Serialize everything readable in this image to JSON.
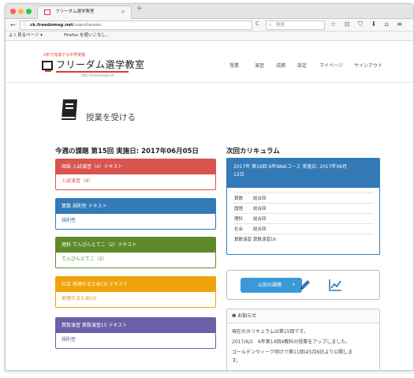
{
  "browser": {
    "tab_title": "フリーダム選学教室",
    "tab_close": "×",
    "new_tab": "+",
    "back": "←",
    "info": "ⓘ",
    "url_host": "ck.freedomsg.net",
    "url_path": "/users/lesson",
    "reload": "C",
    "search_placeholder": "検索",
    "toolbar_icons": "☆ ⊡ ⛉ ⬇ ⌂ ≡",
    "bookmarks": [
      "よく見るページ ▾",
      "Firefox を使いこなし..."
    ]
  },
  "site": {
    "tagline": "2年で完成する中学受験",
    "logo_title": "フリーダム選学教室",
    "logo_url": "http://freedomsg.net",
    "menu": [
      "授業",
      "演習",
      "成績",
      "設定",
      "マイページ",
      "サインアウト"
    ]
  },
  "page": {
    "title": "授業を受ける"
  },
  "this_week": {
    "heading": "今週の課題 第15回 実施日: 2017年06月05日",
    "panels": [
      {
        "header": "国語 入試演習（4）テキスト",
        "link": "入試演習（4）",
        "color": "#d9534f",
        "link_color": "#d9534f"
      },
      {
        "header": "算数 規則性 テキスト",
        "link": "規則性",
        "color": "#337ab7",
        "link_color": "#337ab7"
      },
      {
        "header": "理科 てんびんとてこ（2）テキスト",
        "link": "てんびんとてこ（2）",
        "color": "#5e8a2a",
        "link_color": "#5e8a2a"
      },
      {
        "header": "社会 地理のまとめ(3) テキスト",
        "link": "地理のまとめ(3)",
        "color": "#f0a30a",
        "link_color": "#e68a00"
      },
      {
        "header": "算数演習 算数演習15 テキスト",
        "link": "規則性",
        "color": "#6c5fa8",
        "link_color": "#6c5fa8"
      }
    ]
  },
  "next": {
    "heading": "次回カリキュラム",
    "header_line1": "2017年 第16回 6年Webコース 実施日: 2017年06月",
    "header_line2": "12日",
    "rows": [
      {
        "subject": "算数",
        "topic": "総合回"
      },
      {
        "subject": "国語",
        "topic": "総合回"
      },
      {
        "subject": "理科",
        "topic": "総合回"
      },
      {
        "subject": "社会",
        "topic": "総合回"
      },
      {
        "subject": "算数演習",
        "topic": "算数演習16"
      }
    ]
  },
  "actions": {
    "prev_label": "以前の課題",
    "caret": "▾"
  },
  "notice": {
    "heading": "❶ お知らせ",
    "lines": [
      "現在のカリキュラムは第15回です。",
      "2017/6/2　6年第14回4教科の授業をアップしました。",
      "ゴールデンウィーク明けで第11回は5月8日より公開しま",
      "す。"
    ]
  },
  "colors": {
    "brand_red": "#e53935",
    "primary_blue": "#337ab7",
    "button_blue": "#3a9ad9"
  }
}
